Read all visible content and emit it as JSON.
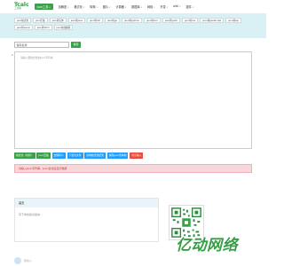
{
  "brand": {
    "logo": "Tcalc",
    "logo_sub": "工具箱"
  },
  "nav": [
    {
      "label": "json工具",
      "active": true,
      "caret": true
    },
    {
      "label": "加解密",
      "active": false,
      "caret": true
    },
    {
      "label": "格式化",
      "active": false,
      "caret": true
    },
    {
      "label": "转换",
      "active": false,
      "caret": true
    },
    {
      "label": "图片",
      "active": false,
      "caret": true
    },
    {
      "label": "计算器",
      "active": false,
      "caret": true
    },
    {
      "label": "数据库",
      "active": false,
      "caret": true
    },
    {
      "label": "网络",
      "active": false,
      "caret": true
    },
    {
      "label": "开发",
      "active": false,
      "caret": true
    },
    {
      "label": "wiki",
      "active": false,
      "caret": true
    },
    {
      "label": "插件",
      "active": false,
      "caret": true
    }
  ],
  "subnav_chips": [
    "json格式化",
    "json压缩",
    "json转实体",
    "json转Java",
    "json转C#",
    "json转go",
    "json转python",
    "json转xml",
    "json转yaml",
    "json转csv",
    "json转JavaScript",
    "json转sql",
    "json转excel",
    "json转html",
    "json在线编辑"
  ],
  "toolbar": {
    "input_placeholder": "保存名称",
    "save_button": "保存"
  },
  "editor": {
    "line_number": "1",
    "placeholder": "请输入要格式化的Json字符串"
  },
  "actions": [
    {
      "label": "格式化（校验）",
      "color": "#3aa14a"
    },
    {
      "label": "json压缩",
      "color": "#3aa14a"
    },
    {
      "label": "去除转义",
      "color": "#1e9fff"
    },
    {
      "label": "下载为文件",
      "color": "#1e9fff"
    },
    {
      "label": "复制格式化结果",
      "color": "#1e9fff"
    },
    {
      "label": "保存Json到本地",
      "color": "#1e9fff"
    },
    {
      "label": "清空输入",
      "color": "#e74c3c"
    }
  ],
  "alert": {
    "text": "请输入Json字符串，Json合法后显示数据"
  },
  "comments": {
    "title": "留言",
    "placeholder": "写下你的建议留言..."
  },
  "watermark": {
    "text": "亿动网络"
  },
  "footer": {
    "user_text": "留言人"
  }
}
